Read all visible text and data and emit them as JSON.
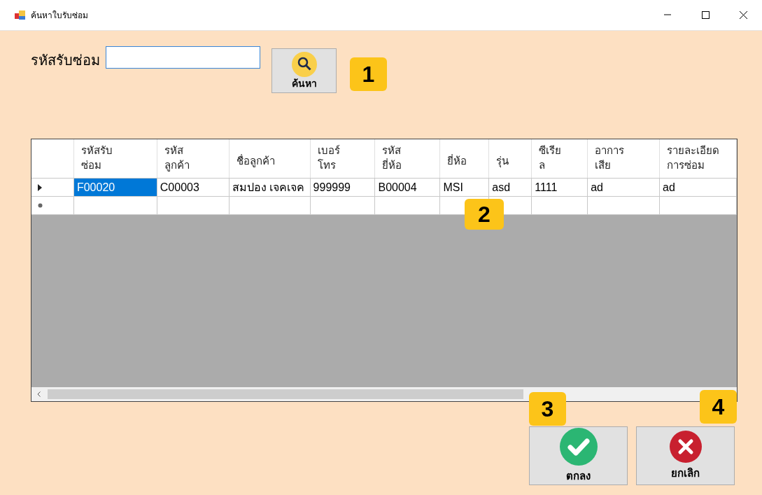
{
  "window": {
    "title": "ค้นหาใบรับซ่อม"
  },
  "search": {
    "label": "รหัสรับซ่อม",
    "button": "ค้นหา"
  },
  "table": {
    "columns": [
      "รหัสรับ\nซ่อม",
      "รหัส\nลูกค้า",
      "ชื่อลูกค้า",
      "เบอร์\nโทร",
      "รหัส\nยี่ห้อ",
      "ยี่ห้อ",
      "รุ่น",
      "ซีเรีย\nล",
      "อาการ\nเสีย",
      "รายละเอียด\nการซ่อม"
    ],
    "rows": [
      {
        "kind": "data",
        "current": true,
        "cells": [
          {
            "text": "F00020",
            "selected": true
          },
          {
            "text": "C00003",
            "selected": false
          },
          {
            "text": "สมปอง เจคเจค",
            "selected": false
          },
          {
            "text": "999999",
            "selected": false
          },
          {
            "text": "B00004",
            "selected": false
          },
          {
            "text": "MSI",
            "selected": false
          },
          {
            "text": "asd",
            "selected": false
          },
          {
            "text": "1111",
            "selected": false
          },
          {
            "text": "ad",
            "selected": false
          },
          {
            "text": "ad",
            "selected": false
          }
        ]
      },
      {
        "kind": "new",
        "current": false,
        "cells": []
      }
    ]
  },
  "buttons": [
    {
      "kind": "ok",
      "label": "ตกลง"
    },
    {
      "kind": "cancel",
      "label": "ยกเลิก"
    }
  ],
  "callouts": [
    "1",
    "2",
    "3",
    "4"
  ]
}
